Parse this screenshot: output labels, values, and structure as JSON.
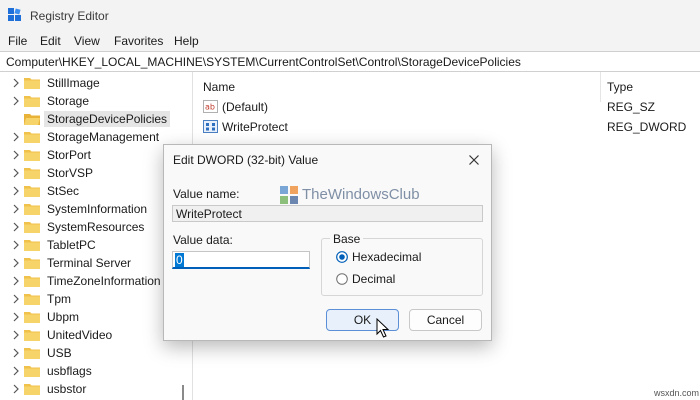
{
  "window": {
    "title": "Registry Editor"
  },
  "menu": [
    "File",
    "Edit",
    "View",
    "Favorites",
    "Help"
  ],
  "address": "Computer\\HKEY_LOCAL_MACHINE\\SYSTEM\\CurrentControlSet\\Control\\StorageDevicePolicies",
  "tree": {
    "items": [
      {
        "label": "StillImage"
      },
      {
        "label": "Storage"
      },
      {
        "label": "StorageDevicePolicies",
        "selected": true
      },
      {
        "label": "StorageManagement"
      },
      {
        "label": "StorPort"
      },
      {
        "label": "StorVSP"
      },
      {
        "label": "StSec"
      },
      {
        "label": "SystemInformation"
      },
      {
        "label": "SystemResources"
      },
      {
        "label": "TabletPC"
      },
      {
        "label": "Terminal Server"
      },
      {
        "label": "TimeZoneInformation"
      },
      {
        "label": "Tpm"
      },
      {
        "label": "Ubpm"
      },
      {
        "label": "UnitedVideo"
      },
      {
        "label": "USB"
      },
      {
        "label": "usbflags"
      },
      {
        "label": "usbstor"
      }
    ]
  },
  "values": {
    "columns": {
      "name": "Name",
      "type": "Type"
    },
    "rows": [
      {
        "name": "(Default)",
        "type": "REG_SZ",
        "icon": "string-value-icon"
      },
      {
        "name": "WriteProtect",
        "type": "REG_DWORD",
        "icon": "binary-value-icon"
      }
    ]
  },
  "dialog": {
    "title": "Edit DWORD (32-bit) Value",
    "value_name_label": "Value name:",
    "value_name": "WriteProtect",
    "value_data_label": "Value data:",
    "value_data": "0",
    "base_label": "Base",
    "base_options": [
      {
        "label": "Hexadecimal",
        "checked": true
      },
      {
        "label": "Decimal",
        "checked": false
      }
    ],
    "ok_label": "OK",
    "cancel_label": "Cancel"
  },
  "watermark": "TheWindowsClub",
  "site": "wsxdn.com",
  "colors": {
    "accent": "#0078d4",
    "folder": "#f0c24b",
    "title_bg": "#f3f3f3"
  }
}
